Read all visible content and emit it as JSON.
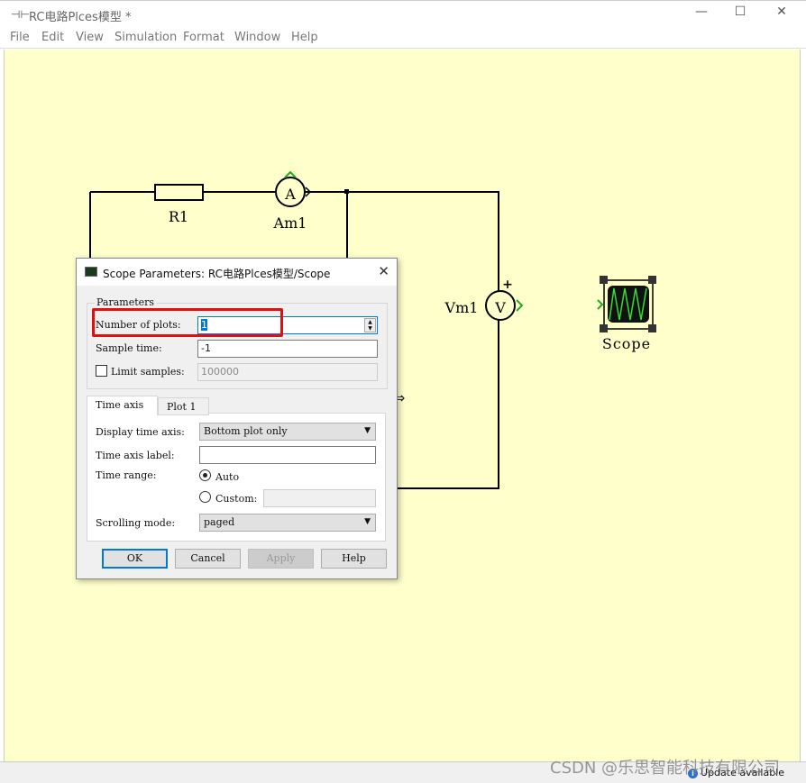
{
  "window": {
    "title": "RC电路Plces模型 *",
    "app_icon": "simulink-model-icon",
    "minimize": "—",
    "maximize": "☐",
    "close": "✕"
  },
  "menu": [
    "File",
    "Edit",
    "View",
    "Simulation",
    "Format",
    "Window",
    "Help"
  ],
  "diagram": {
    "resistor": "R1",
    "ammeter": "Am1",
    "ammeter_glyph": "A",
    "voltmeter": "Vm1",
    "voltmeter_glyph": "V",
    "plus": "+",
    "scope": "Scope",
    "colors": {
      "canvas": "#ffffcc",
      "port": "#22aa22",
      "scope_screen": "#111111",
      "scope_trace": "#33dd33"
    }
  },
  "dialog": {
    "title": "Scope Parameters: RC电路Plces模型/Scope",
    "group_label": "Parameters",
    "number_of_plots_label": "Number of plots:",
    "number_of_plots_value": "1",
    "sample_time_label": "Sample time:",
    "sample_time_value": "-1",
    "limit_samples_label": "Limit samples:",
    "limit_samples_checked": false,
    "limit_samples_value": "100000",
    "tabs": [
      "Time axis",
      "Plot 1"
    ],
    "active_tab": "Time axis",
    "display_time_axis_label": "Display time axis:",
    "display_time_axis_value": "Bottom plot only",
    "time_axis_label_label": "Time axis label:",
    "time_axis_label_value": "",
    "time_range_label": "Time range:",
    "time_range_auto": "Auto",
    "time_range_custom": "Custom:",
    "time_range_selected": "Auto",
    "custom_value": "",
    "scrolling_mode_label": "Scrolling mode:",
    "scrolling_mode_value": "paged",
    "buttons": {
      "ok": "OK",
      "cancel": "Cancel",
      "apply": "Apply",
      "help": "Help"
    },
    "highlight_color": "#e01010"
  },
  "status": {
    "update": "Update available"
  },
  "watermark": "CSDN @乐思智能科技有限公司"
}
